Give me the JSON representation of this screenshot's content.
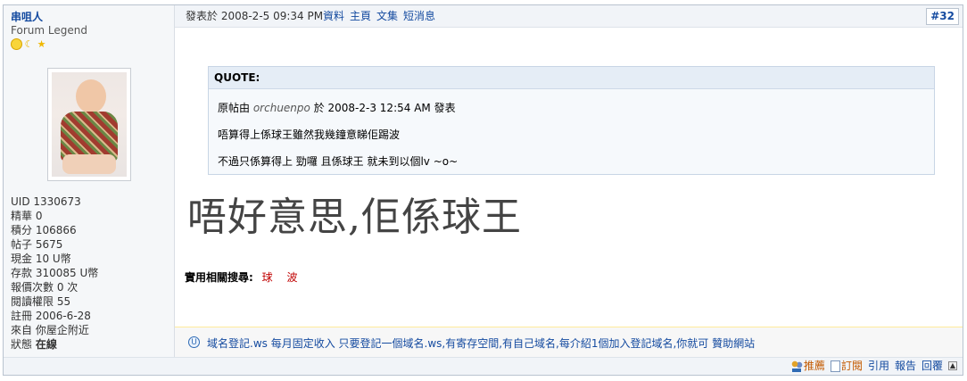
{
  "author": {
    "name": "串咀人",
    "title": "Forum Legend",
    "rank_icons": [
      "sun-icon",
      "moon-icon",
      "star-icon"
    ],
    "stats": [
      {
        "key": "uid",
        "text": "UID 1330673"
      },
      {
        "key": "essence",
        "text": "精華 0"
      },
      {
        "key": "points",
        "text": "積分 106866"
      },
      {
        "key": "posts",
        "text": "帖子 5675"
      },
      {
        "key": "cash",
        "text": "現金 10 U幣"
      },
      {
        "key": "deposit",
        "text": "存款 310085 U幣"
      },
      {
        "key": "reports",
        "text": "報價次數 0 次"
      },
      {
        "key": "read_perm",
        "text": "閱讀權限 55"
      },
      {
        "key": "registered",
        "text": "註冊 2006-6-28"
      },
      {
        "key": "location",
        "text": "來自 你屋企附近"
      }
    ],
    "status_label": "狀態",
    "status_value": "在線"
  },
  "post": {
    "date": "發表於 2008-2-5 09:34 PM",
    "links": [
      "資料",
      "主頁",
      "文集",
      "短消息"
    ],
    "number": "#32",
    "quote": {
      "title": "QUOTE:",
      "prefix": "原帖由",
      "author": "orchuenpo",
      "meta": "於 2008-2-3 12:54 AM 發表",
      "line1": "唔算得上係球王雖然我幾鐘意睇佢踢波",
      "line2": "不過只係算得上 勁囉 且係球王 就未到以個lv ~o~"
    },
    "body": "唔好意思,佢係球王",
    "related_label": "實用相關搜尋:",
    "related_keywords": [
      "球",
      "波"
    ]
  },
  "ad": {
    "icon": "info-circle-icon",
    "text": "域名登記.ws 每月固定收入 只要登記一個域名.ws,有寄存空間,有自己域名,每介紹1個加入登記域名,你就可 贊助網站"
  },
  "footer": {
    "recommend": "推薦",
    "subscribe": "訂閱",
    "quote": "引用",
    "report": "報告",
    "reply": "回覆"
  },
  "colors": {
    "link": "#154ba0",
    "keyword": "#c00000",
    "border": "#b9c3cf",
    "header_bg": "#f1f4f8",
    "quote_bg": "#f6f9fc"
  }
}
